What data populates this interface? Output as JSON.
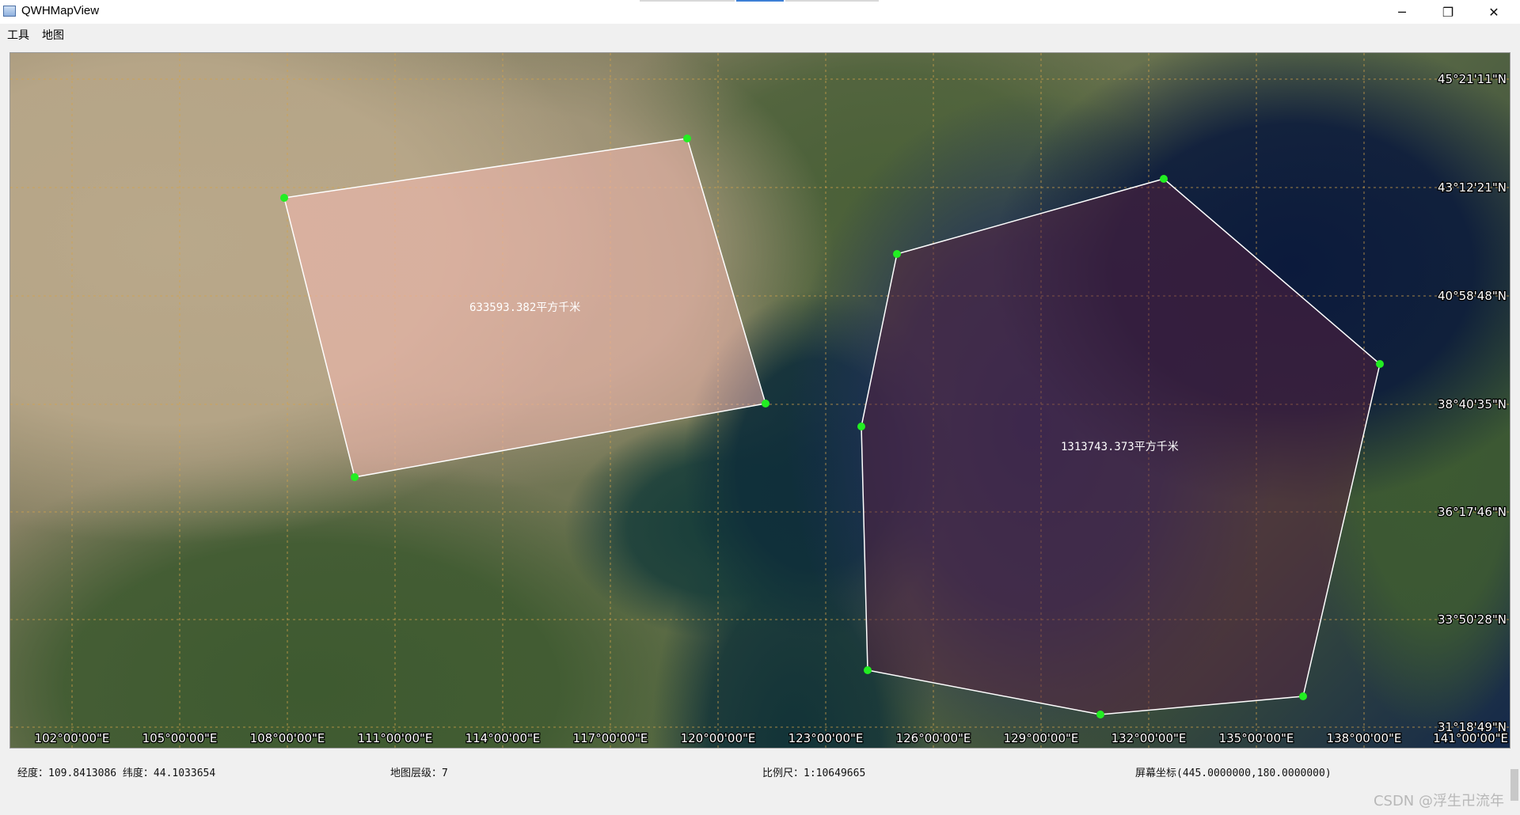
{
  "window": {
    "title": "QWHMapView",
    "controls": {
      "minimize": "─",
      "restore": "❐",
      "close": "✕"
    }
  },
  "menu": {
    "items": [
      "工具",
      "地图"
    ]
  },
  "map": {
    "lat_labels": [
      "45°21'11\"N",
      "43°12'21\"N",
      "40°58'48\"N",
      "38°40'35\"N",
      "36°17'46\"N",
      "33°50'28\"N",
      "31°18'49\"N"
    ],
    "lon_labels": [
      "102°00'00\"E",
      "105°00'00\"E",
      "108°00'00\"E",
      "111°00'00\"E",
      "114°00'00\"E",
      "117°00'00\"E",
      "120°00'00\"E",
      "123°00'00\"E",
      "126°00'00\"E",
      "129°00'00\"E",
      "132°00'00\"E",
      "135°00'00\"E",
      "138°00'00\"E",
      "141°00'00\"E"
    ],
    "polygons": [
      {
        "area_label": "633593.382平方千米",
        "fill": "#f4b8b0",
        "fill_opacity": 0.55
      },
      {
        "area_label": "1313743.373平方千米",
        "fill": "#5a1f3e",
        "fill_opacity": 0.5
      }
    ],
    "vertex_color": "#22ee22",
    "edge_color": "#ffffff",
    "grid_color": "#d4a24a"
  },
  "status": {
    "coordinates": "经度：109.8413086  纬度：44.1033654",
    "zoom": "地图层级：7",
    "scale": "比例尺：1:10649665",
    "screen": "屏幕坐标(445.0000000,180.0000000)"
  },
  "watermark": "CSDN @浮生卍流年"
}
